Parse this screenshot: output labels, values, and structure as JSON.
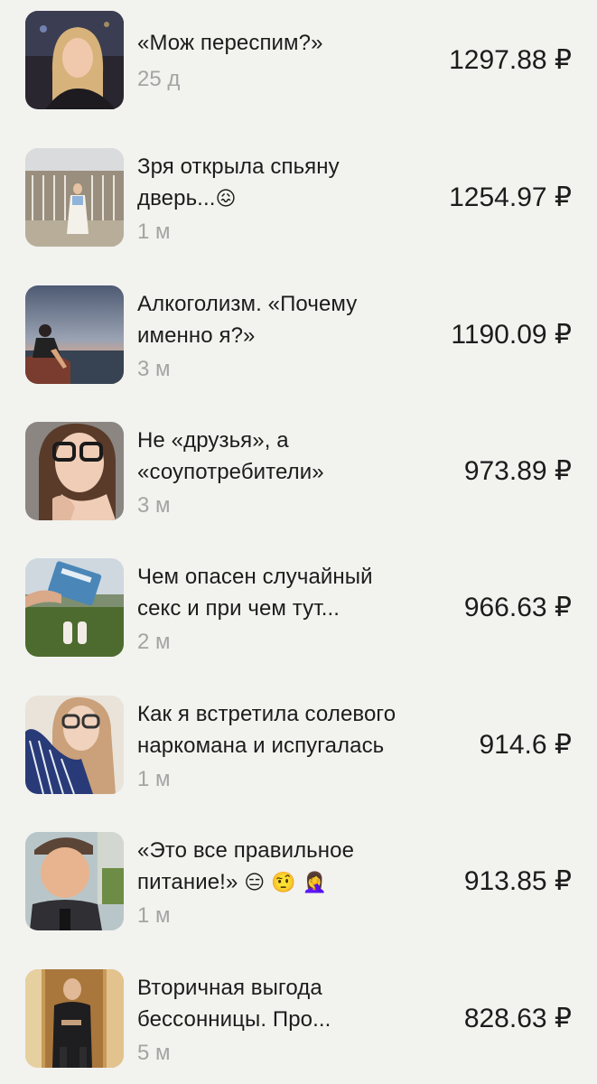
{
  "items": [
    {
      "title_line1": "«Мож переспим?»",
      "title_line2": "",
      "emojis": "",
      "age": "25 д",
      "amount": "1297.88 ₽",
      "thumb_icon": "woman-portrait-photo"
    },
    {
      "title_line1": "Зря открыла спьяну",
      "title_line2": "дверь...",
      "emojis": "😖",
      "age": "1 м",
      "amount": "1254.97 ₽",
      "thumb_icon": "woman-by-fence-photo"
    },
    {
      "title_line1": "Алкоголизм. «Почему",
      "title_line2": "именно я?»",
      "emojis": "",
      "age": "3 м",
      "amount": "1190.09 ₽",
      "thumb_icon": "person-on-rock-sunset-photo"
    },
    {
      "title_line1": "Не «друзья», а",
      "title_line2": "«соупотребители»",
      "emojis": "",
      "age": "3 м",
      "amount": "973.89 ₽",
      "thumb_icon": "woman-glasses-portrait-photo"
    },
    {
      "title_line1": "Чем опасен случайный",
      "title_line2": "секс и при чем тут...",
      "emojis": "",
      "age": "2 м",
      "amount": "966.63 ₽",
      "thumb_icon": "book-on-grass-photo"
    },
    {
      "title_line1": "Как я встретила солевого",
      "title_line2": "наркомана и испугалась",
      "emojis": "",
      "age": "1 м",
      "amount": "914.6 ₽",
      "thumb_icon": "woman-glasses-striped-shirt-photo"
    },
    {
      "title_line1": "«Это все правильное",
      "title_line2": "питание!»",
      "emojis": "😑 🤨 🤦‍♀️",
      "age": "1 м",
      "amount": "913.85 ₽",
      "thumb_icon": "person-cap-outdoors-photo"
    },
    {
      "title_line1": "Вторичная выгода",
      "title_line2": "бессонницы. Про...",
      "emojis": "",
      "age": "5 м",
      "amount": "828.63 ₽",
      "thumb_icon": "woman-mirror-selfie-photo"
    }
  ]
}
